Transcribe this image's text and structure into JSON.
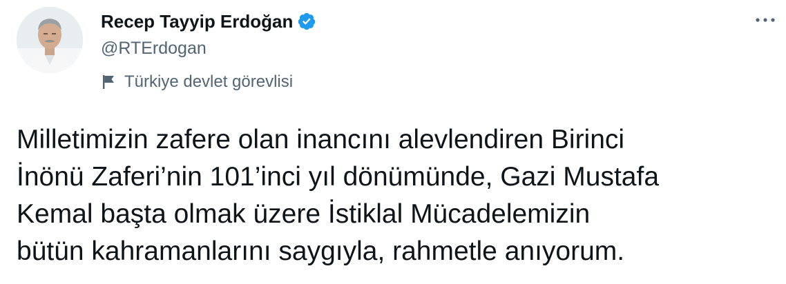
{
  "author": {
    "display_name": "Recep Tayyip Erdoğan",
    "handle": "@RTErdogan",
    "verified": true,
    "label": "Türkiye devlet görevlisi"
  },
  "icons": {
    "verified": "verified-badge-icon",
    "label": "flag-icon",
    "more": "more-options-icon",
    "avatar": "profile-photo"
  },
  "tweet": {
    "lines": [
      "Milletimizin zafere olan inancını alevlendiren Birinci",
      "İnönü Zaferi’nin 101’inci yıl dönümünde, Gazi Mustafa",
      "Kemal başta olmak üzere İstiklal Mücadelemizin",
      "bütün kahramanlarını saygıyla, rahmetle anıyorum."
    ]
  },
  "colors": {
    "text": "#0f1419",
    "secondary": "#536471",
    "verified": "#1d9bf0"
  }
}
